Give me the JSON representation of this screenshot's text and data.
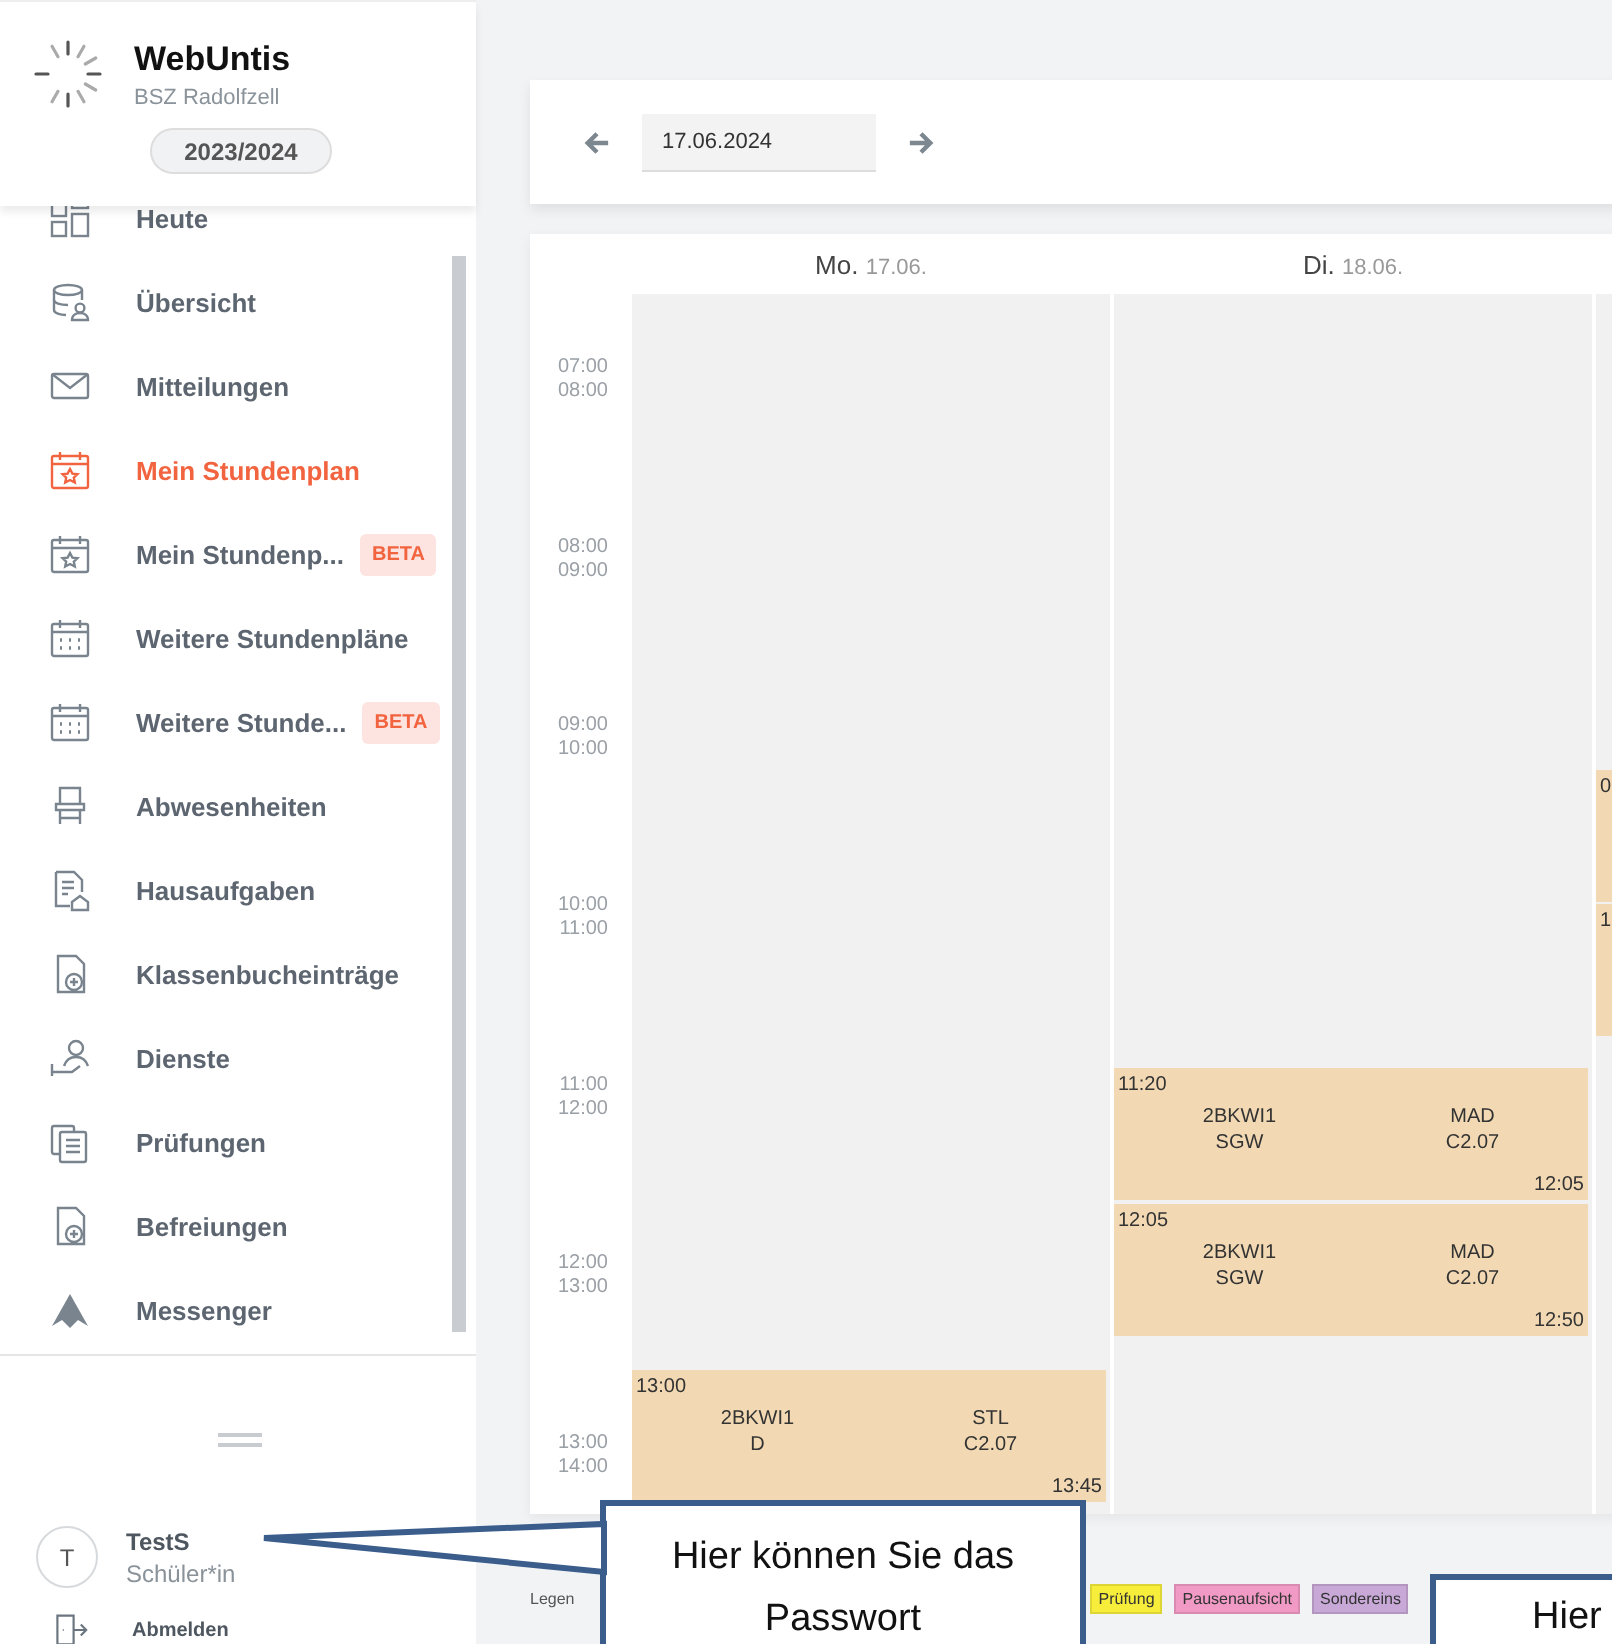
{
  "sidebar": {
    "brand": {
      "title": "WebUntis",
      "subtitle": "BSZ Radolfzell"
    },
    "school_year": "2023/2024",
    "items": [
      {
        "label": "Heute",
        "selected": false
      },
      {
        "label": "Übersicht",
        "selected": false
      },
      {
        "label": "Mitteilungen",
        "selected": false
      },
      {
        "label": "Mein Stundenplan",
        "selected": true
      },
      {
        "label": "Mein Stundenp...",
        "selected": false,
        "badge": "BETA"
      },
      {
        "label": "Weitere Stundenpläne",
        "selected": false
      },
      {
        "label": "Weitere Stunde...",
        "selected": false,
        "badge": "BETA"
      },
      {
        "label": "Abwesenheiten",
        "selected": false
      },
      {
        "label": "Hausaufgaben",
        "selected": false
      },
      {
        "label": "Klassenbucheinträge",
        "selected": false
      },
      {
        "label": "Dienste",
        "selected": false
      },
      {
        "label": "Prüfungen",
        "selected": false
      },
      {
        "label": "Befreiungen",
        "selected": false
      },
      {
        "label": "Messenger",
        "selected": false
      }
    ],
    "user": {
      "avatar": "T",
      "name": "TestS",
      "role": "Schüler*in"
    },
    "logout": "Abmelden"
  },
  "toolbar": {
    "date": "17.06.2024"
  },
  "timetable": {
    "hours": [
      {
        "from": "07:00",
        "to": "08:00"
      },
      {
        "from": "08:00",
        "to": "09:00"
      },
      {
        "from": "09:00",
        "to": "10:00"
      },
      {
        "from": "10:00",
        "to": "11:00"
      },
      {
        "from": "11:00",
        "to": "12:00"
      },
      {
        "from": "12:00",
        "to": "13:00"
      },
      {
        "from": "13:00",
        "to": "14:00"
      }
    ],
    "days": [
      {
        "name": "Mo.",
        "date": "17.06.",
        "lessons": [
          {
            "start": "13:00",
            "end": "13:45",
            "class": "2BKWI1",
            "subject": "D",
            "teacher": "STL",
            "room": "C2.07"
          }
        ]
      },
      {
        "name": "Di.",
        "date": "18.06.",
        "lessons": [
          {
            "start": "11:20",
            "end": "12:05",
            "class": "2BKWI1",
            "subject": "SGW",
            "teacher": "MAD",
            "room": "C2.07"
          },
          {
            "start": "12:05",
            "end": "12:50",
            "class": "2BKWI1",
            "subject": "SGW",
            "teacher": "MAD",
            "room": "C2.07"
          }
        ]
      }
    ],
    "cut_day": {
      "lessons": [
        {
          "text": "0"
        },
        {
          "text": "1"
        }
      ]
    }
  },
  "legend": {
    "label": "Legen",
    "items": [
      {
        "label": "Prüfung",
        "color": "#f7ee3c"
      },
      {
        "label": "Pausenaufsicht",
        "color": "#f19ac6"
      },
      {
        "label": "Sondereins",
        "color": "#c8a8d6"
      }
    ]
  },
  "callouts": [
    {
      "text": "Hier können Sie das Passwort"
    },
    {
      "text": "Hier"
    }
  ]
}
